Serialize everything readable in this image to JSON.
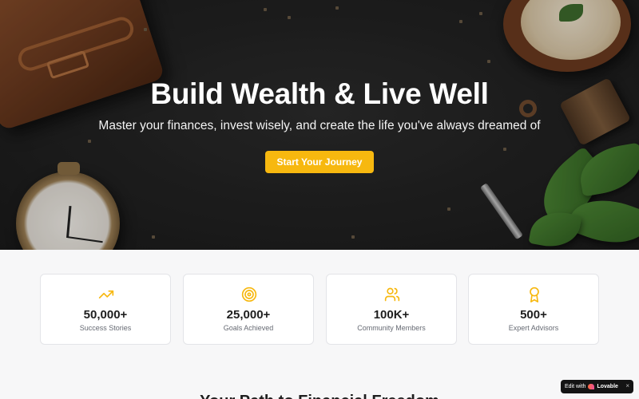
{
  "hero": {
    "title": "Build Wealth & Live Well",
    "subtitle": "Master your finances, invest wisely, and create the life you've always dreamed of",
    "cta_label": "Start Your Journey"
  },
  "stats": [
    {
      "icon": "trending-up-icon",
      "value": "50,000+",
      "label": "Success Stories"
    },
    {
      "icon": "target-icon",
      "value": "25,000+",
      "label": "Goals Achieved"
    },
    {
      "icon": "users-icon",
      "value": "100K+",
      "label": "Community Members"
    },
    {
      "icon": "award-icon",
      "value": "500+",
      "label": "Expert Advisors"
    }
  ],
  "next_section": {
    "heading": "Your Path to Financial Freedom"
  },
  "badge": {
    "prefix": "Edit with",
    "brand": "Lovable",
    "close": "×"
  },
  "colors": {
    "accent": "#f7b80f",
    "text_dark": "#1e1e1e",
    "text_muted": "#666a73",
    "page_bg": "#f7f7f8"
  }
}
